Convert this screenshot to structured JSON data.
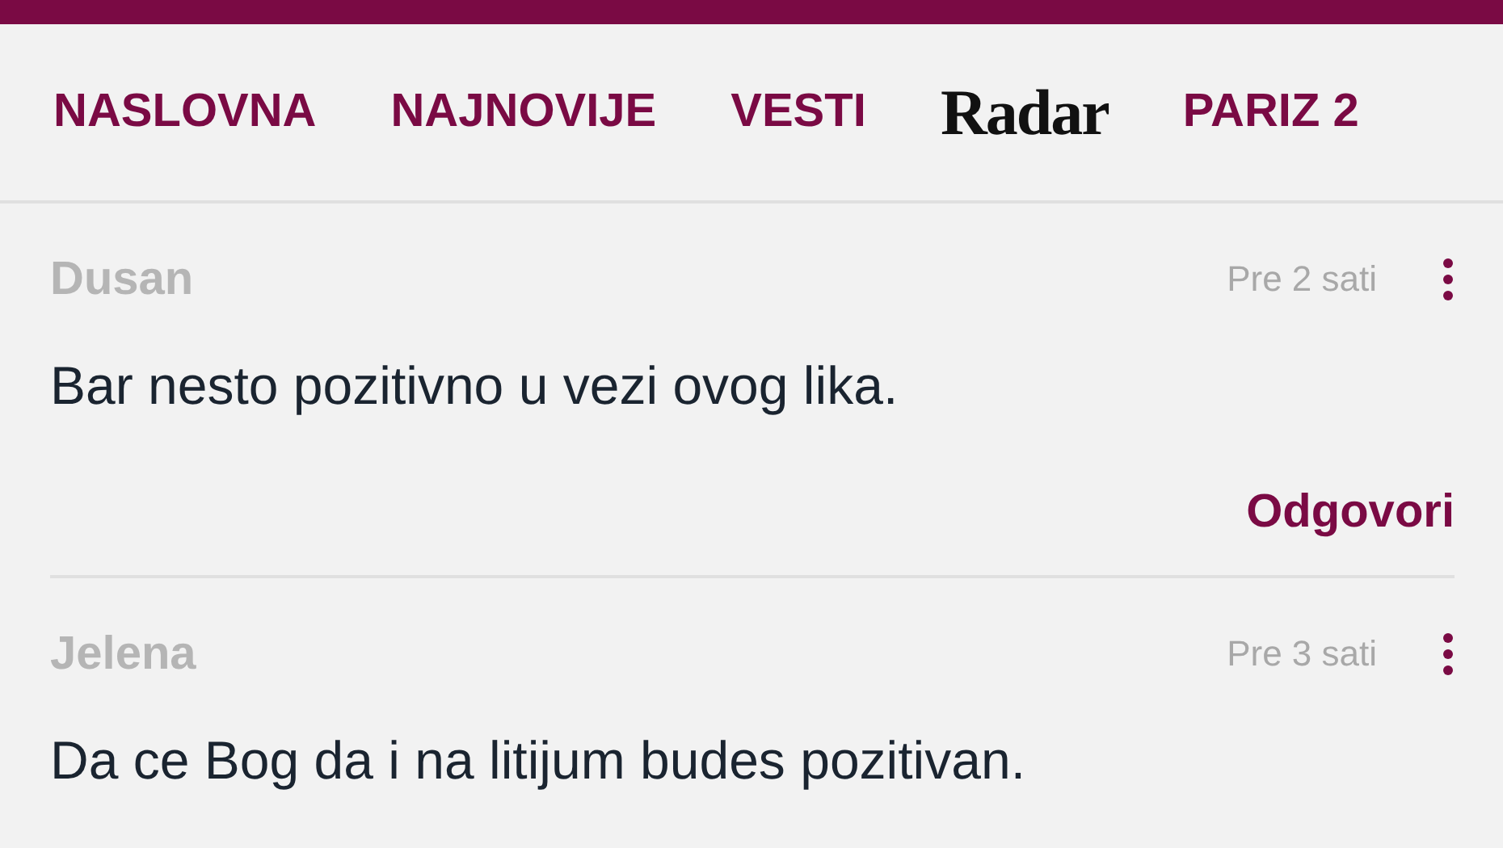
{
  "nav": [
    {
      "kind": "link",
      "label": "NASLOVNA"
    },
    {
      "kind": "link",
      "label": "NAJNOVIJE"
    },
    {
      "kind": "link",
      "label": "VESTI"
    },
    {
      "kind": "logo",
      "label": "Radar"
    },
    {
      "kind": "link",
      "label": "PARIZ 2"
    }
  ],
  "comments": [
    {
      "author": "Dusan",
      "time": "Pre 2 sati",
      "text": "Bar nesto pozitivno u vezi ovog lika.",
      "reply": "Odgovori"
    },
    {
      "author": "Jelena",
      "time": "Pre 3 sati",
      "text": "Da ce Bog da i na litijum budes pozitivan."
    }
  ]
}
